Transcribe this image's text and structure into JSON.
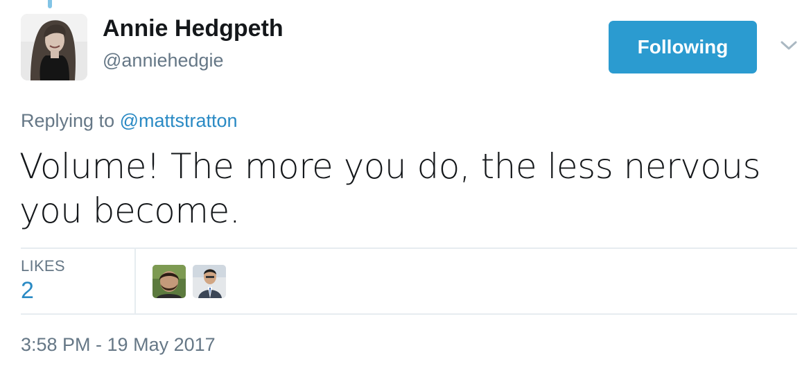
{
  "author": {
    "display_name": "Annie Hedgpeth",
    "handle": "@anniehedgie"
  },
  "follow_button": {
    "label": "Following",
    "color": "#2b9bd0"
  },
  "reply": {
    "prefix": "Replying to",
    "target": "@mattstratton"
  },
  "tweet": {
    "text": "Volume! The more you do, the less nervous you become."
  },
  "engagement": {
    "likes_label": "LIKES",
    "likes_count": "2",
    "likers": [
      "avatar-liker-1",
      "avatar-liker-2"
    ]
  },
  "timestamp": "3:58 PM - 19 May 2017",
  "icons": {
    "menu": "chevron-down-icon"
  },
  "colors": {
    "link": "#2a8ac4",
    "secondary_text": "#657786",
    "divider": "#e6ecf0"
  }
}
